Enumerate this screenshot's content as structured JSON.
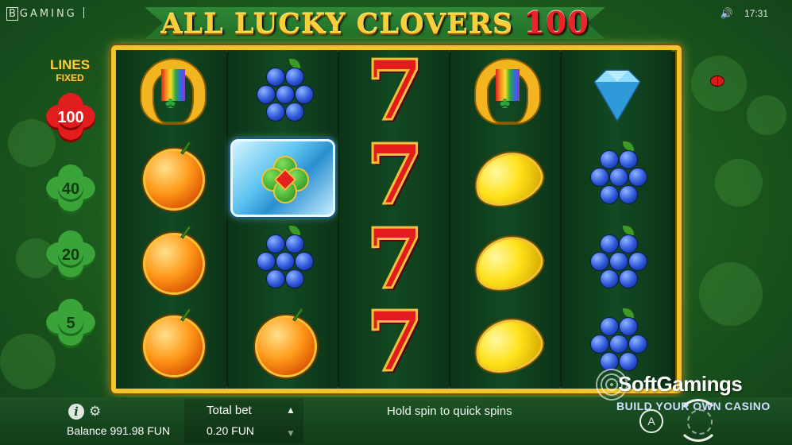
{
  "brand": {
    "logo": "BGAMING"
  },
  "status": {
    "time": "17:31",
    "sound_icon": "speaker-icon"
  },
  "game": {
    "title_word": "ALL LUCKY CLOVERS",
    "title_number": "100"
  },
  "lines": {
    "title": "LINES",
    "subtitle": "FIXED",
    "options": [
      {
        "value": "100",
        "active": true
      },
      {
        "value": "40",
        "active": false
      },
      {
        "value": "20",
        "active": false
      },
      {
        "value": "5",
        "active": false
      }
    ]
  },
  "reels": [
    [
      "horseshoe",
      "orange",
      "orange",
      "orange"
    ],
    [
      "grapes",
      "clover-wild",
      "grapes",
      "orange"
    ],
    [
      "seven",
      "seven",
      "seven",
      "seven"
    ],
    [
      "horseshoe",
      "lemon",
      "lemon",
      "lemon"
    ],
    [
      "diamond",
      "grapes",
      "grapes",
      "grapes"
    ]
  ],
  "seven_glyph": "7",
  "bottom": {
    "info_label": "i",
    "balance": "Balance 991.98 FUN",
    "bet_label": "Total bet",
    "bet_value": "0.20 FUN",
    "hint": "Hold spin to quick spins",
    "auto_label": "A"
  },
  "watermark": {
    "title": "SoftGamings",
    "subtitle": "BUILD YOUR OWN CASINO"
  },
  "colors": {
    "gold": "#f2c52c",
    "red": "#e31b1b",
    "green": "#1f6c27"
  }
}
